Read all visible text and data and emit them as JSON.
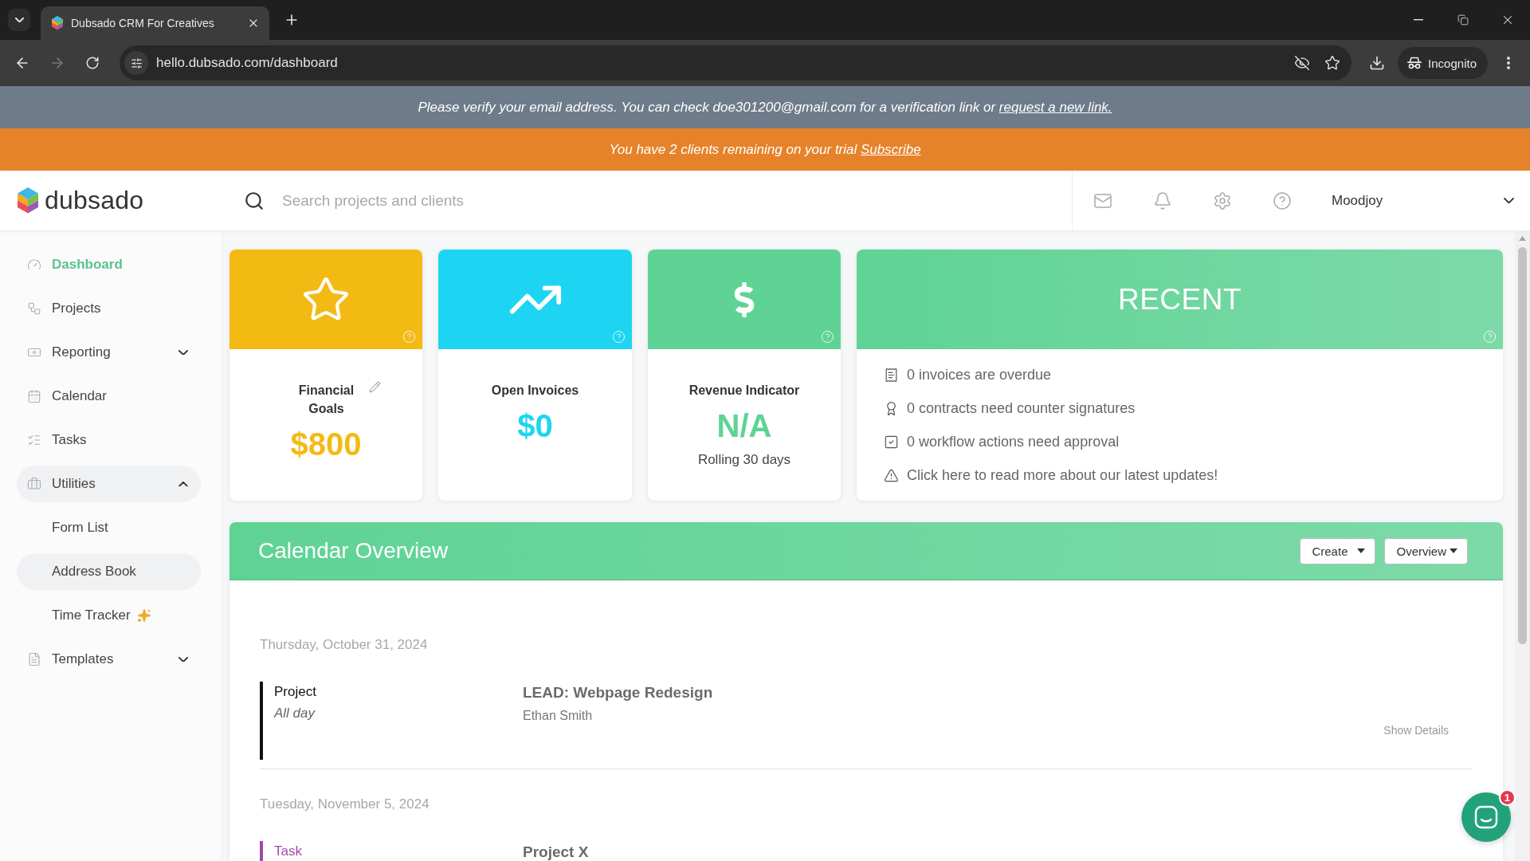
{
  "browser": {
    "tab_title": "Dubsado CRM For Creatives",
    "url": "hello.dubsado.com/dashboard",
    "profile": "Incognito"
  },
  "verify_banner": {
    "text": "Please verify your email address. You can check doe301200@gmail.com for a verification link or",
    "link": "request a new link."
  },
  "trial_banner": {
    "text": "You have 2 clients remaining on your trial",
    "link": "Subscribe"
  },
  "header": {
    "logo": "dubsado",
    "search": {
      "placeholder": "Search projects and clients"
    },
    "user": "Moodjoy"
  },
  "sidebar": {
    "items": [
      {
        "label": "Dashboard",
        "kind": "link",
        "selected": true
      },
      {
        "label": "Projects",
        "kind": "link",
        "selected": false
      },
      {
        "label": "Reporting",
        "kind": "group",
        "selected": false,
        "expanded": false
      },
      {
        "label": "Calendar",
        "kind": "link",
        "selected": false
      },
      {
        "label": "Tasks",
        "kind": "link",
        "selected": false
      },
      {
        "label": "Utilities",
        "kind": "group",
        "selected": false,
        "expanded": true,
        "children": [
          {
            "label": "Form List",
            "selected": false,
            "hovered": false,
            "new": false
          },
          {
            "label": "Address Book",
            "selected": false,
            "hovered": true,
            "new": false
          },
          {
            "label": "Time Tracker",
            "selected": false,
            "hovered": false,
            "new": true
          }
        ]
      },
      {
        "label": "Templates",
        "kind": "group",
        "selected": false,
        "expanded": false
      }
    ]
  },
  "widgets": [
    {
      "kind": "goal",
      "title": "Financial Goals",
      "value": "$800",
      "color": "#f4ba14"
    },
    {
      "kind": "invoices",
      "title": "Open Invoices",
      "value": "$0",
      "color": "#1dd5f2"
    },
    {
      "kind": "revenue",
      "title": "Revenue Indicator",
      "value": "N/A",
      "note": "Rolling 30 days",
      "color": "#5fd394"
    }
  ],
  "recent": {
    "title": "RECENT",
    "items": [
      {
        "kind": "invoices",
        "text": "0 invoices are overdue"
      },
      {
        "kind": "contracts",
        "text": "0 contracts need counter signatures"
      },
      {
        "kind": "workflow",
        "text": "0 workflow actions need approval"
      },
      {
        "kind": "updates",
        "text": "Click here to read more about our latest updates!"
      }
    ]
  },
  "calendar": {
    "title": "Calendar Overview",
    "buttons": [
      "Create",
      "Overview"
    ],
    "days": [
      {
        "date": "Thursday, October 31, 2024",
        "events": [
          {
            "label": "Project",
            "time": "All day",
            "title": "LEAD: Webpage Redesign",
            "client": "Ethan Smith",
            "action": "Show Details",
            "color": "#111111"
          }
        ]
      },
      {
        "date": "Tuesday, November 5, 2024",
        "events": [
          {
            "label": "Task",
            "title": "Project X",
            "color": "#a04aa8"
          }
        ]
      }
    ]
  },
  "chat": {
    "badge": "1"
  }
}
